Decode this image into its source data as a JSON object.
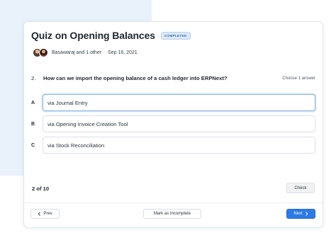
{
  "quiz": {
    "title": "Quiz on Opening Balances",
    "status_badge": "COMPLETED",
    "authors": "Basawaraj and 1 other",
    "date": "Sep 16, 2021"
  },
  "question": {
    "number": "2.",
    "text": "How can we import the opening balance of a cash ledger into ERPNext?",
    "hint": "Choose 1 answer",
    "options": [
      {
        "letter": "A",
        "text": "via Journal Entry",
        "selected": true
      },
      {
        "letter": "B",
        "text": "via Opening Invoice Creation Tool",
        "selected": false
      },
      {
        "letter": "C",
        "text": "via Stock Reconciliation",
        "selected": false
      }
    ]
  },
  "progress": "2 of 10",
  "buttons": {
    "check": "Check",
    "prev": "Prev",
    "mark_incomplete": "Mark as Incomplete",
    "next": "Next"
  },
  "colors": {
    "primary": "#2c7ae6",
    "badge_text": "#2f6ea8",
    "badge_bg": "#dce9f7",
    "selected_border": "#8fb4de"
  }
}
